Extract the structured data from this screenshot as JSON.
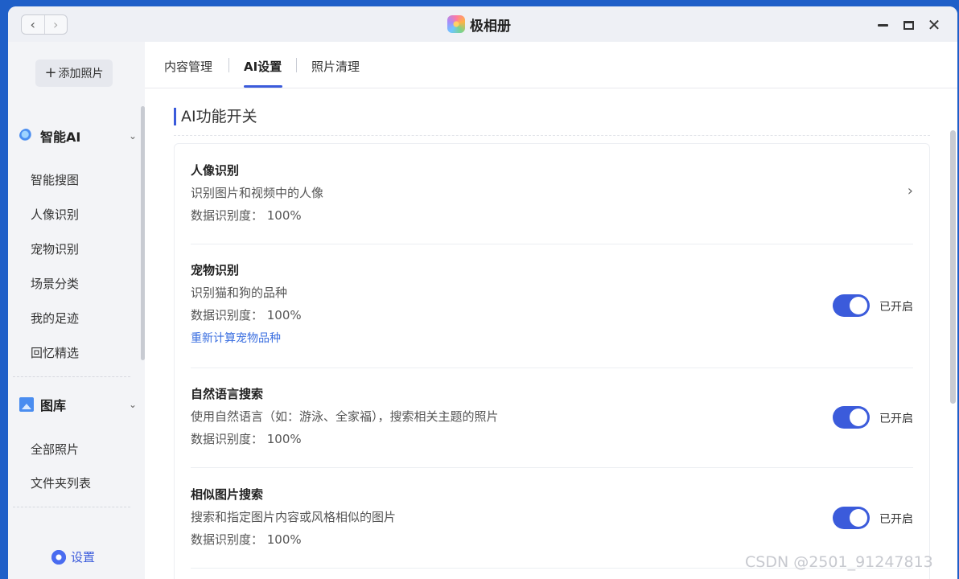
{
  "titlebar": {
    "back_icon": "chevron-left-icon",
    "forward_icon": "chevron-right-icon",
    "app_title": "极相册",
    "minimize_icon": "minimize-icon",
    "maximize_icon": "maximize-icon",
    "close_icon": "close-icon"
  },
  "sidebar": {
    "add_photo": "添加照片",
    "groups": [
      {
        "label": "智能AI",
        "icon": "ai-search-icon",
        "items": [
          "智能搜图",
          "人像识别",
          "宠物识别",
          "场景分类",
          "我的足迹",
          "回忆精选"
        ]
      },
      {
        "label": "图库",
        "icon": "gallery-icon",
        "items": [
          "全部照片",
          "文件夹列表"
        ]
      }
    ],
    "settings": "设置"
  },
  "tabs": [
    {
      "label": "内容管理",
      "active": false
    },
    {
      "label": "AI设置",
      "active": true
    },
    {
      "label": "照片清理",
      "active": false
    }
  ],
  "section": {
    "title": "AI功能开关"
  },
  "features": [
    {
      "title": "人像识别",
      "description": "识别图片和视频中的人像",
      "accuracy": "数据识别度： 100%",
      "control": "chevron"
    },
    {
      "title": "宠物识别",
      "description": "识别猫和狗的品种",
      "accuracy": "数据识别度： 100%",
      "link": "重新计算宠物品种",
      "toggle_state": "已开启",
      "enabled": true
    },
    {
      "title": "自然语言搜索",
      "description": "使用自然语言（如：游泳、全家福），搜索相关主题的照片",
      "accuracy": "数据识别度： 100%",
      "toggle_state": "已开启",
      "enabled": true
    },
    {
      "title": "相似图片搜索",
      "description": "搜索和指定图片内容或风格相似的图片",
      "accuracy": "数据识别度： 100%",
      "toggle_state": "已开启",
      "enabled": true
    }
  ],
  "watermark": "CSDN @2501_91247813",
  "colors": {
    "accent": "#3b5bdb",
    "link": "#3b6fe0",
    "outer_background": "#1f5fc8"
  }
}
